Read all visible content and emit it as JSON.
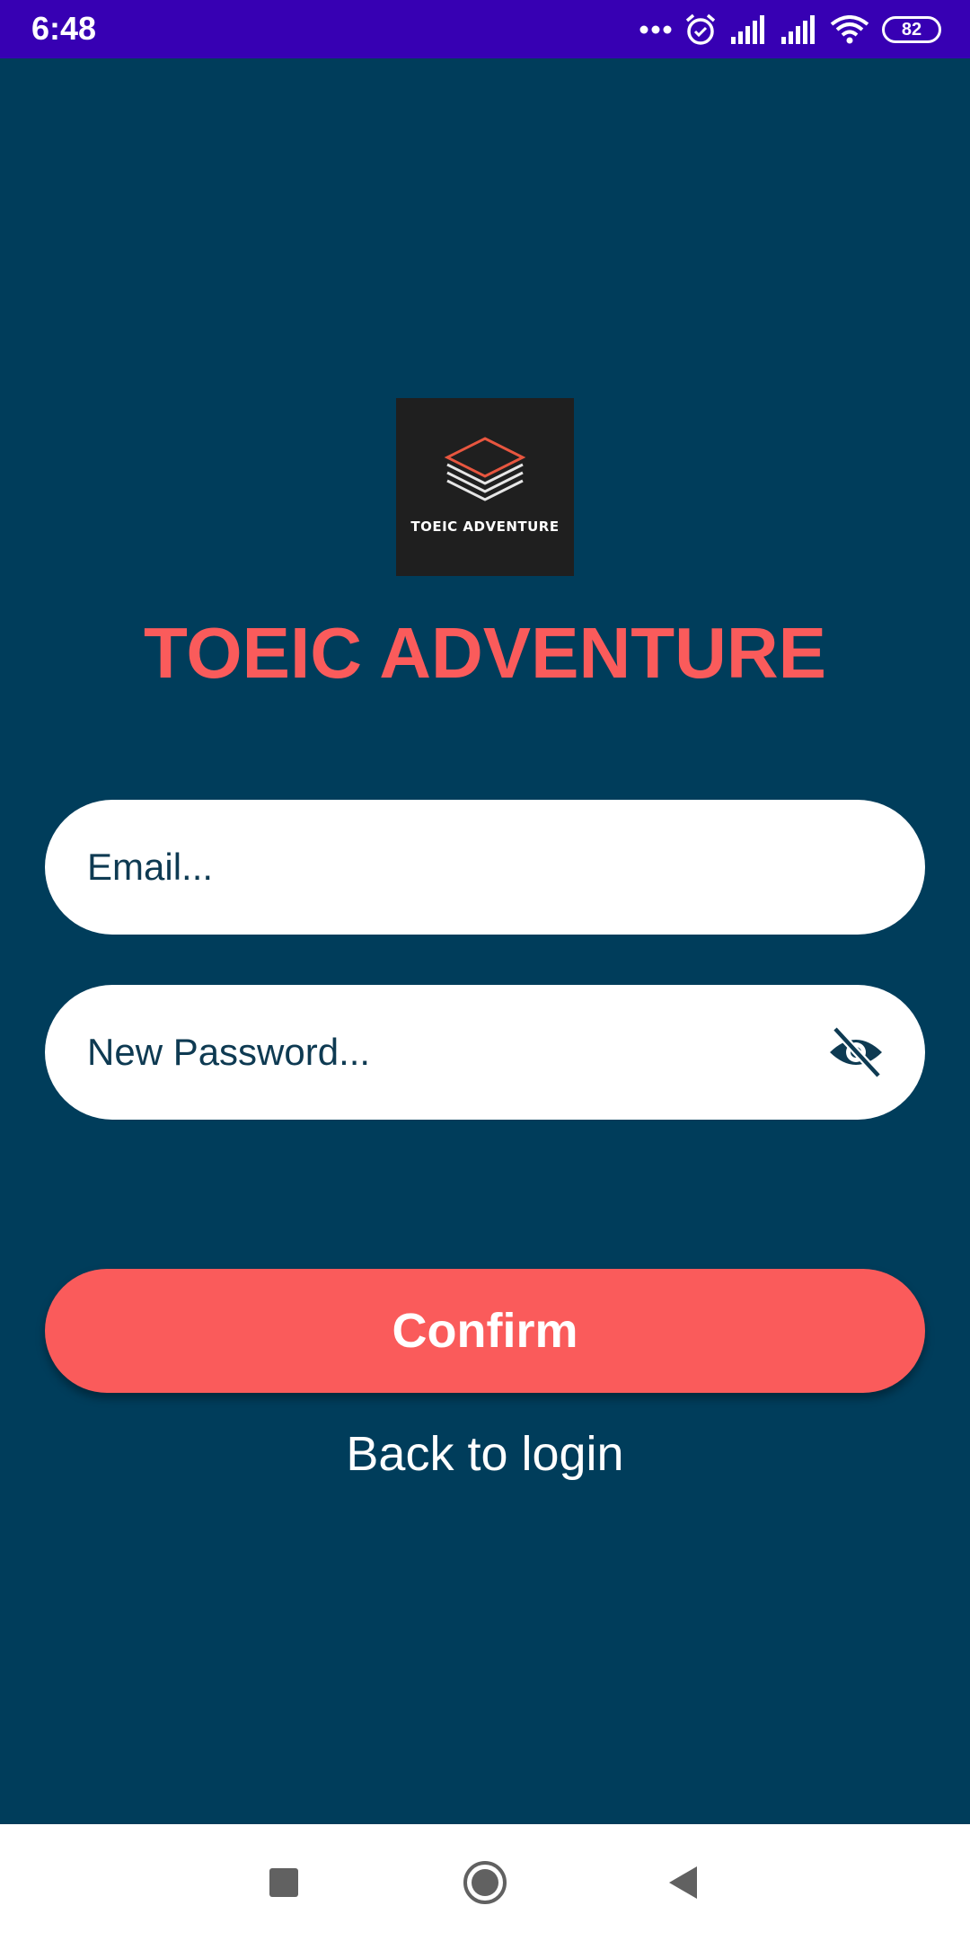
{
  "status_bar": {
    "time": "6:48",
    "battery_level": "82",
    "icons": [
      "more-dots-icon",
      "alarm-icon",
      "signal-icon",
      "signal-icon",
      "wifi-icon",
      "battery-icon"
    ],
    "background_color": "#3700b3"
  },
  "logo": {
    "text": "TOEIC ADVENTURE",
    "icon": "layers-icon"
  },
  "app_title": "TOEIC ADVENTURE",
  "form": {
    "email_placeholder": "Email...",
    "email_value": "",
    "password_placeholder": "New Password...",
    "password_value": "",
    "password_visibility_icon": "eye-off-icon",
    "confirm_label": "Confirm",
    "back_to_login_label": "Back to login"
  },
  "nav_bar": {
    "buttons": [
      "recents-icon",
      "home-icon",
      "back-icon"
    ]
  },
  "colors": {
    "background": "#003d5b",
    "accent": "#fa5b5b",
    "field_background": "#ffffff",
    "field_text": "#0e3a52"
  }
}
